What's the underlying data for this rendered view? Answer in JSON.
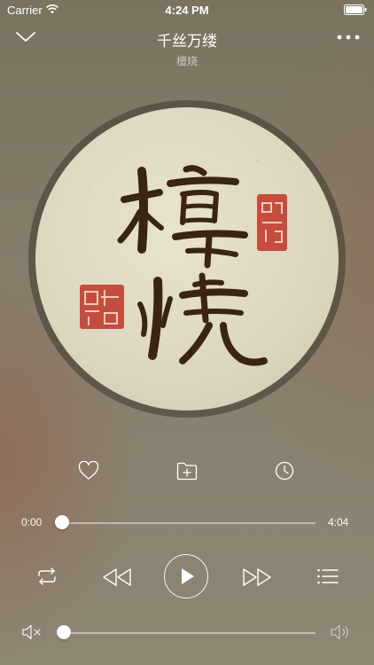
{
  "status_bar": {
    "carrier": "Carrier",
    "time": "4:24 PM",
    "icons": [
      "wifi-icon",
      "battery-icon"
    ]
  },
  "header": {
    "song_title": "千丝万缕",
    "artist": "檀烧",
    "left_icon": "chevron-down-icon",
    "right_icon": "more-icon"
  },
  "album": {
    "art_text": "檀 烧"
  },
  "actions": [
    "heart-icon",
    "add-to-folder-icon",
    "clock-icon"
  ],
  "progress": {
    "current": "0:00",
    "total": "4:04",
    "fraction": 0.0
  },
  "controls": [
    "repeat-icon",
    "rewind-icon",
    "play-icon",
    "fast-forward-icon",
    "playlist-icon"
  ],
  "volume": {
    "fraction": 0.0,
    "left_icon": "mute-icon",
    "right_icon": "volume-icon"
  },
  "colors": {
    "background": "#857d6a",
    "ink": "#3a2a1a",
    "seal_red": "#c0392b",
    "parchment": "#e3ddc7"
  }
}
